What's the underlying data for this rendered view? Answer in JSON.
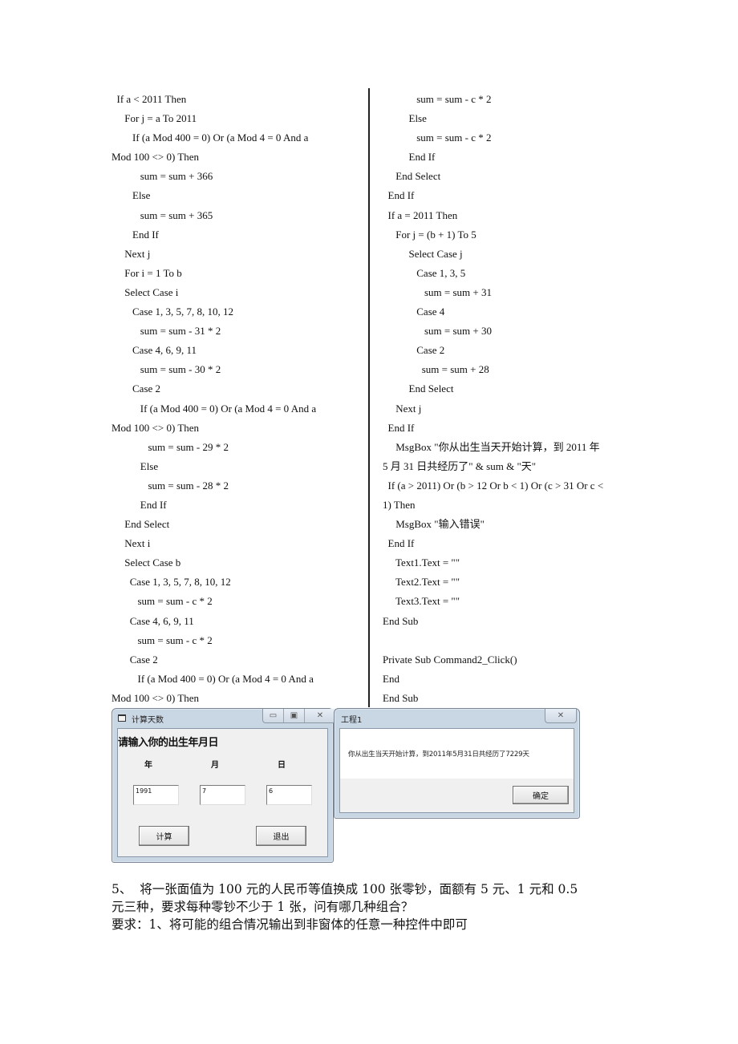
{
  "code": {
    "left_column": [
      "  If a < 2011 Then",
      "     For j = a To 2011",
      "        If (a Mod 400 = 0) Or (a Mod 4 = 0 And a",
      "Mod 100 <> 0) Then",
      "           sum = sum + 366",
      "        Else",
      "           sum = sum + 365",
      "        End If",
      "     Next j",
      "     For i = 1 To b",
      "     Select Case i",
      "        Case 1, 3, 5, 7, 8, 10, 12",
      "           sum = sum - 31 * 2",
      "        Case 4, 6, 9, 11",
      "           sum = sum - 30 * 2",
      "        Case 2",
      "           If (a Mod 400 = 0) Or (a Mod 4 = 0 And a",
      "Mod 100 <> 0) Then",
      "              sum = sum - 29 * 2",
      "           Else",
      "              sum = sum - 28 * 2",
      "           End If",
      "     End Select",
      "     Next i",
      "     Select Case b",
      "       Case 1, 3, 5, 7, 8, 10, 12",
      "          sum = sum - c * 2",
      "       Case 4, 6, 9, 11",
      "          sum = sum - c * 2",
      "       Case 2",
      "          If (a Mod 400 = 0) Or (a Mod 4 = 0 And a",
      "Mod 100 <> 0) Then"
    ],
    "right_column": [
      "             sum = sum - c * 2",
      "          Else",
      "             sum = sum - c * 2",
      "          End If",
      "     End Select",
      "  End If",
      "  If a = 2011 Then",
      "     For j = (b + 1) To 5",
      "          Select Case j",
      "             Case 1, 3, 5",
      "                sum = sum + 31",
      "             Case 4",
      "                sum = sum + 30",
      "             Case 2",
      "               sum = sum + 28",
      "          End Select",
      "     Next j",
      "  End If",
      "     MsgBox \"你从出生当天开始计算，到 2011 年",
      "5 月 31 日共经历了\" & sum & \"天\"",
      "  If (a > 2011) Or (b > 12 Or b < 1) Or (c > 31 Or c <",
      "1) Then",
      "     MsgBox \"输入错误\"",
      "  End If",
      "     Text1.Text = \"\"",
      "     Text2.Text = \"\"",
      "     Text3.Text = \"\"",
      "End Sub",
      "",
      "Private Sub Command2_Click()",
      "End",
      "End Sub"
    ]
  },
  "form_window": {
    "title": "计算天数",
    "controls": {
      "minimize": "▭",
      "maximize": "▣",
      "close": "✕"
    },
    "prompt": "请输入你的出生年月日",
    "labels": {
      "year": "年",
      "month": "月",
      "day": "日"
    },
    "inputs": {
      "year": "1991",
      "month": "7",
      "day": "6"
    },
    "buttons": {
      "calculate": "计算",
      "exit": "退出"
    }
  },
  "msgbox_window": {
    "title": "工程1",
    "close": "✕",
    "message": "你从出生当天开始计算，到2011年5月31日共经历了7229天",
    "ok_button": "确定"
  },
  "question": {
    "lines": [
      "5、  将一张面值为 100 元的人民币等值换成 100 张零钞，面额有 5 元、1 元和 0.5",
      "元三种，要求每种零钞不少于 1 张，问有哪几种组合？",
      "要求：1、将可能的组合情况输出到非窗体的任意一种控件中即可"
    ]
  }
}
